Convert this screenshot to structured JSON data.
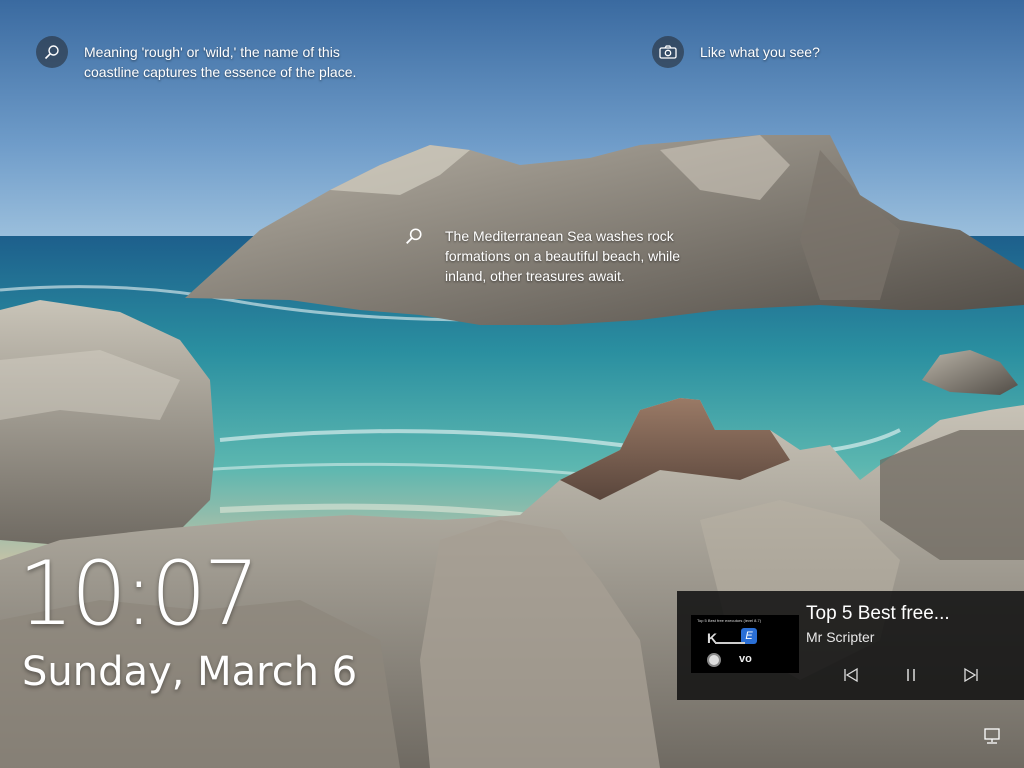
{
  "spotlight": {
    "fact1": "Meaning 'rough' or 'wild,' the name of this coastline captures the essence of the place.",
    "like_prompt": "Like what you see?",
    "fact2": "The Mediterranean Sea washes rock formations on a beautiful beach, while inland, other treasures await."
  },
  "clock": {
    "time": "10:07",
    "date": "Sunday, March 6"
  },
  "media": {
    "title": "Top 5 Best free...",
    "artist": "Mr Scripter",
    "thumbnail_caption": "Top 5 Best free executors (level 8.7)",
    "controls": [
      "previous",
      "pause",
      "next"
    ]
  },
  "icons": {
    "search": "search-icon",
    "camera": "camera-icon",
    "network": "network-icon"
  },
  "colors": {
    "sky_top": "#3a6aa0",
    "sea": "#2a8fa0",
    "panel": "#121212"
  }
}
